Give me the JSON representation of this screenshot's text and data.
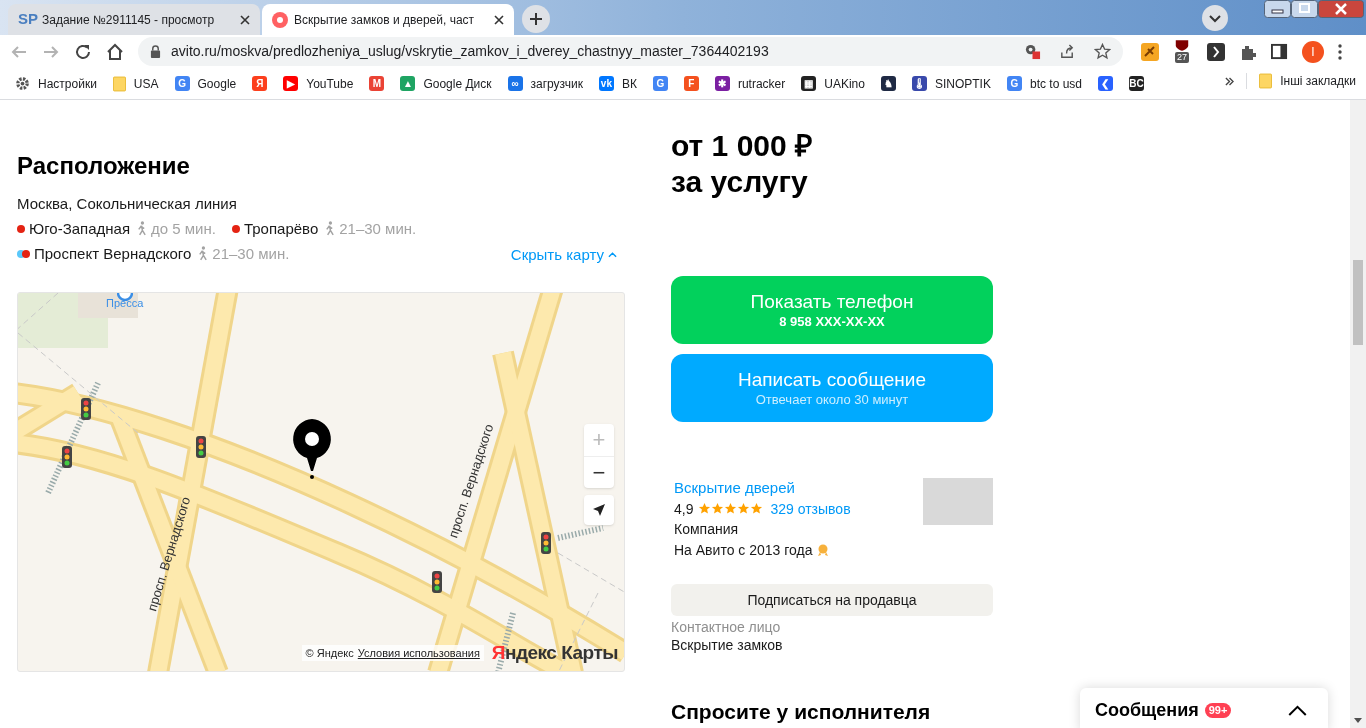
{
  "tabs": [
    {
      "title": "Задание №2911145 - просмотр",
      "favicon_text": "SP",
      "selected": false
    },
    {
      "title": "Вскрытие замков и дверей, част",
      "selected": true
    }
  ],
  "address": "avito.ru/moskva/predlozheniya_uslug/vskrytie_zamkov_i_dverey_chastnyy_master_7364402193",
  "extension_badge": "27",
  "profile_initial": "I",
  "bookmarks": [
    {
      "kind": "gear",
      "label": "Настройки"
    },
    {
      "kind": "folder",
      "label": "USA"
    },
    {
      "kind": "site",
      "label": "Google",
      "color": "#4285f4",
      "icon_text": "G"
    },
    {
      "kind": "site",
      "icon_text": "Я",
      "color": "#fc3f1d"
    },
    {
      "kind": "site",
      "label": "YouTube",
      "color": "#ff0000",
      "icon_text": "▶"
    },
    {
      "kind": "site",
      "icon_text": "M",
      "color": "#ea4335"
    },
    {
      "kind": "site",
      "label": "Google Диск",
      "color": "#1fa463",
      "icon_text": "▲"
    },
    {
      "kind": "site",
      "label": "загрузчик",
      "color": "#1a73e8",
      "icon_text": "∞"
    },
    {
      "kind": "site",
      "label": "ВК",
      "color": "#0077ff",
      "icon_text": "vk"
    },
    {
      "kind": "site",
      "icon_text": "G",
      "color": "#4285f4"
    },
    {
      "kind": "site",
      "icon_text": "F",
      "color": "#f4511e"
    },
    {
      "kind": "site",
      "label": "rutracker",
      "color": "#7b1fa2",
      "icon_text": "✱"
    },
    {
      "kind": "site",
      "label": "UAKino",
      "color": "#222222",
      "icon_text": "▦"
    },
    {
      "kind": "site",
      "icon_text": "♞",
      "color": "#1f2a44"
    },
    {
      "kind": "site",
      "label": "SINOPTIK",
      "color": "#3949ab",
      "icon_text": "🌡"
    },
    {
      "kind": "site",
      "label": "btc to usd",
      "color": "#4285f4",
      "icon_text": "G"
    },
    {
      "kind": "site",
      "icon_text": "❮",
      "color": "#2962ff"
    },
    {
      "kind": "site",
      "icon_text": "BC",
      "color": "#222222"
    }
  ],
  "other_bookmarks": "Інші закладки",
  "location": {
    "heading": "Расположение",
    "address": "Москва, Сокольническая линия",
    "stations": [
      {
        "name": "Юго-Западная",
        "lines": [
          {
            "color": "#e42313"
          }
        ],
        "time": "до 5 мин."
      },
      {
        "name": "Тропарёво",
        "lines": [
          {
            "color": "#e42313"
          }
        ],
        "time": "21–30 мин."
      },
      {
        "name": "Проспект Вернадского",
        "lines": [
          {
            "color": "#5ac8fa"
          },
          {
            "color": "#e42313"
          }
        ],
        "time": "21–30 мин."
      }
    ],
    "toggle_link": "Скрыть карту"
  },
  "map": {
    "poi_label": "Пресса",
    "street_labels": [
      "просп. Вернадского",
      "просп. Вернадского"
    ],
    "zoom_in": "+",
    "zoom_out": "−",
    "copyright": "© Яндекс",
    "terms_link": "Условия использования",
    "logo_first_letter": "Я",
    "logo_rest": "ндекс Карты"
  },
  "price": {
    "line1": "от 1 000 ₽",
    "line2": "за услугу"
  },
  "actions": [
    {
      "kind": "phone",
      "title": "Показать телефон",
      "subtitle": "8 958 XXX-XX-XX"
    },
    {
      "kind": "message",
      "title": "Написать сообщение",
      "subtitle": "Отвечает около 30 минут"
    }
  ],
  "seller": {
    "name": "Вскрытие дверей",
    "rating": "4,9",
    "stars": 5,
    "reviews": "329 отзывов",
    "type": "Компания",
    "since": "На Авито с 2013 года",
    "subscribe": "Подписаться на продавца",
    "contact_label": "Контактное лицо",
    "contact_name": "Вскрытие замков"
  },
  "ask_heading": "Спросите у исполнителя",
  "messages": {
    "label": "Сообщения",
    "badge": "99+"
  }
}
